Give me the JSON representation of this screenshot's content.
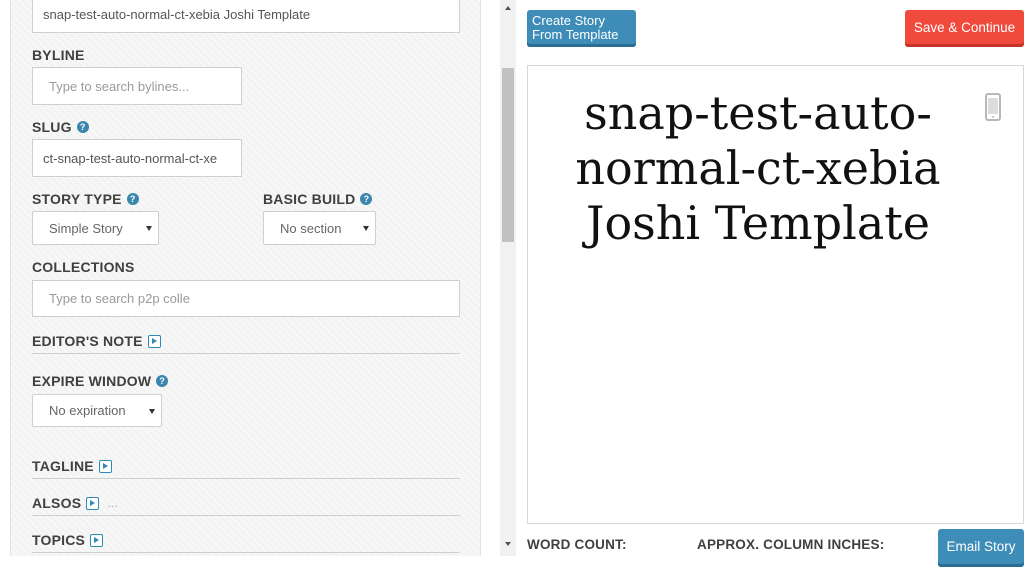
{
  "form": {
    "headline_value": "snap-test-auto-normal-ct-xebia Joshi Template",
    "byline": {
      "label": "BYLINE",
      "placeholder": "Type to search bylines..."
    },
    "slug": {
      "label": "SLUG",
      "value": "ct-snap-test-auto-normal-ct-xe"
    },
    "story_type": {
      "label": "STORY TYPE",
      "selected": "Simple Story"
    },
    "basic_build": {
      "label": "BASIC BUILD",
      "selected": "No section"
    },
    "collections": {
      "label": "COLLECTIONS",
      "placeholder": "Type to search p2p colle"
    },
    "editors_note": {
      "label": "EDITOR'S NOTE"
    },
    "expire_window": {
      "label": "EXPIRE WINDOW",
      "selected": "No expiration"
    },
    "tagline": {
      "label": "TAGLINE"
    },
    "alsos": {
      "label": "ALSOS",
      "extra": "..."
    },
    "topics": {
      "label": "TOPICS"
    }
  },
  "help_glyph": "?",
  "preview": {
    "create_template_label": "Create Story From Template",
    "save_label": "Save & Continue",
    "headline": "snap-test-auto-normal-ct-xebia Joshi Template",
    "word_count_label": "WORD COUNT:",
    "column_inches_label": "APPROX. COLUMN INCHES:",
    "email_label": "Email Story"
  },
  "colors": {
    "primary_button": "#3d8db8",
    "save_button": "#f04a3c",
    "help_icon": "#3a87ad"
  },
  "icons": [
    "help-icon",
    "play-icon",
    "phone-icon",
    "chevron-down-icon"
  ]
}
